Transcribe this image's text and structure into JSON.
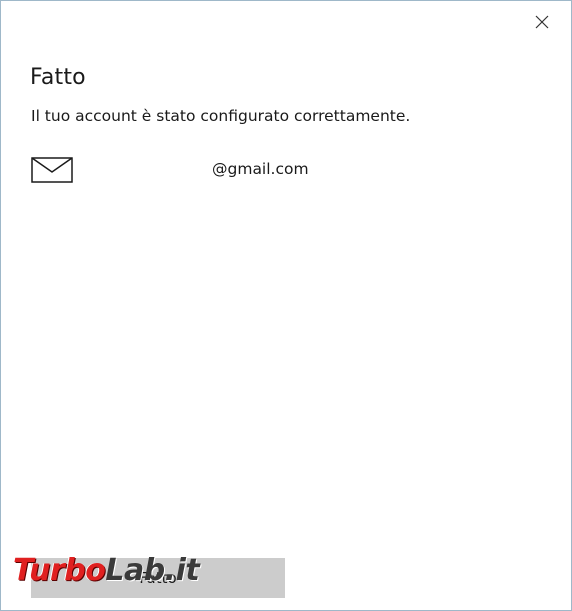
{
  "dialog": {
    "title": "Fatto",
    "subtitle": "Il tuo account è stato configurato correttamente.",
    "account": {
      "email": "@gmail.com",
      "icon": "mail-icon"
    },
    "close_icon": "close-icon",
    "done_button_label": "Fatto"
  },
  "watermark": {
    "part1": "Turbo",
    "part2": "Lab.it"
  },
  "colors": {
    "window_border": "#9fb8c9",
    "button_bg": "#cccccc",
    "text": "#1a1a1a",
    "watermark_red": "#e02020"
  }
}
